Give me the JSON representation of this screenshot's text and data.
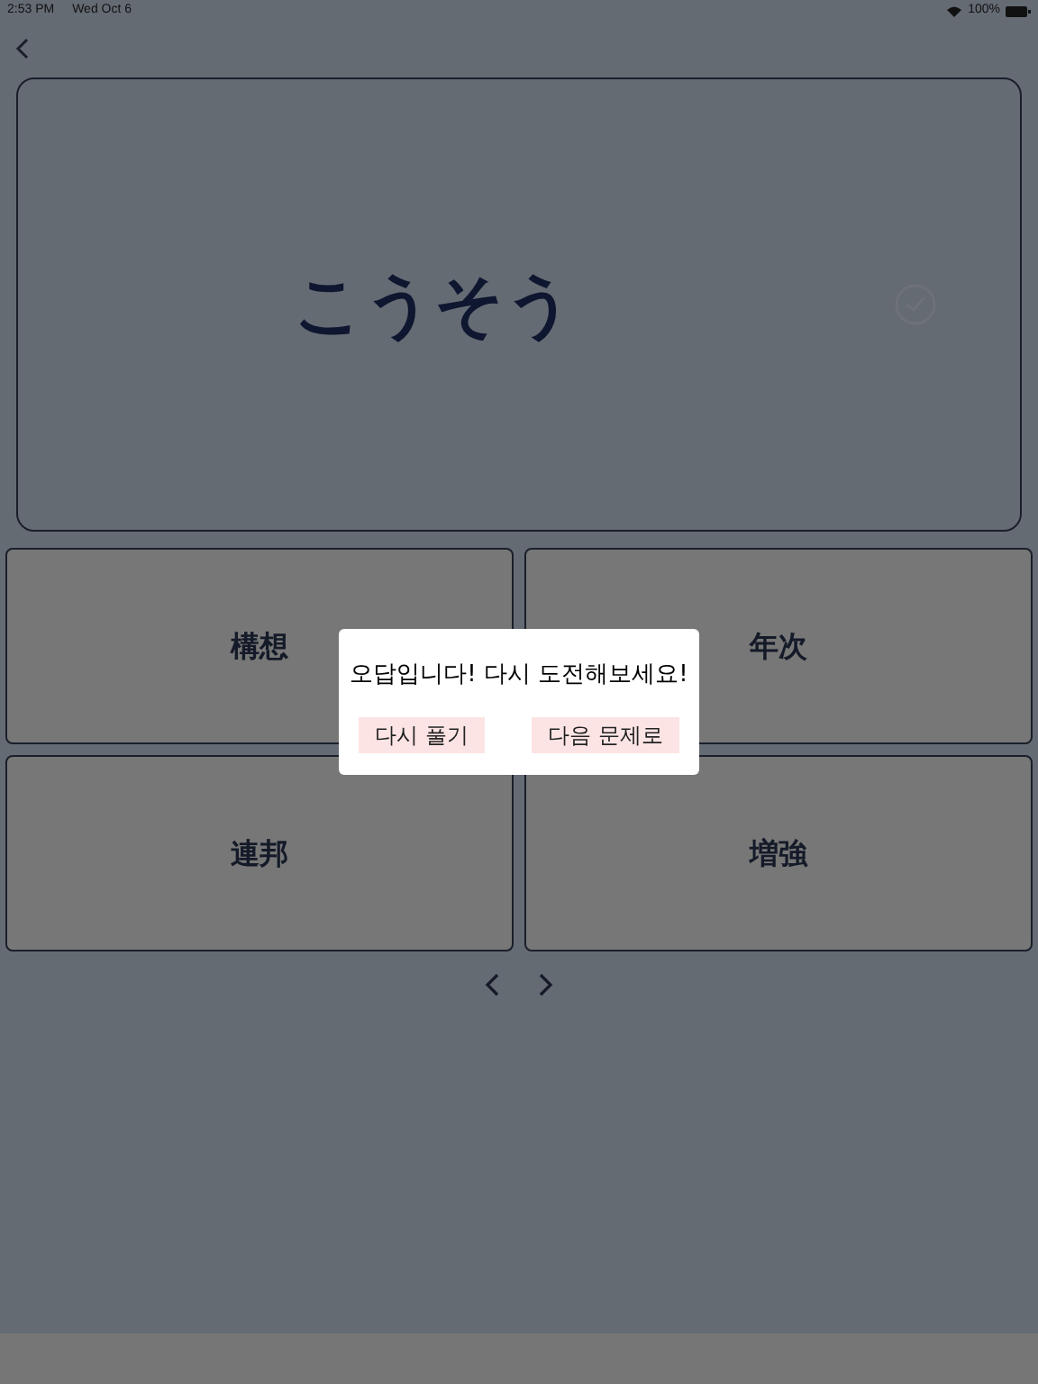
{
  "status_bar": {
    "time": "2:53 PM",
    "date": "Wed Oct 6",
    "battery": "100%"
  },
  "question": {
    "reading": "こうそう"
  },
  "choices": [
    {
      "text": "構想"
    },
    {
      "text": "年次"
    },
    {
      "text": "連邦"
    },
    {
      "text": "増強"
    }
  ],
  "dialog": {
    "message": "오답입니다! 다시 도전해보세요!",
    "buttons": [
      "다시 풀기",
      "다음 문제로"
    ]
  }
}
